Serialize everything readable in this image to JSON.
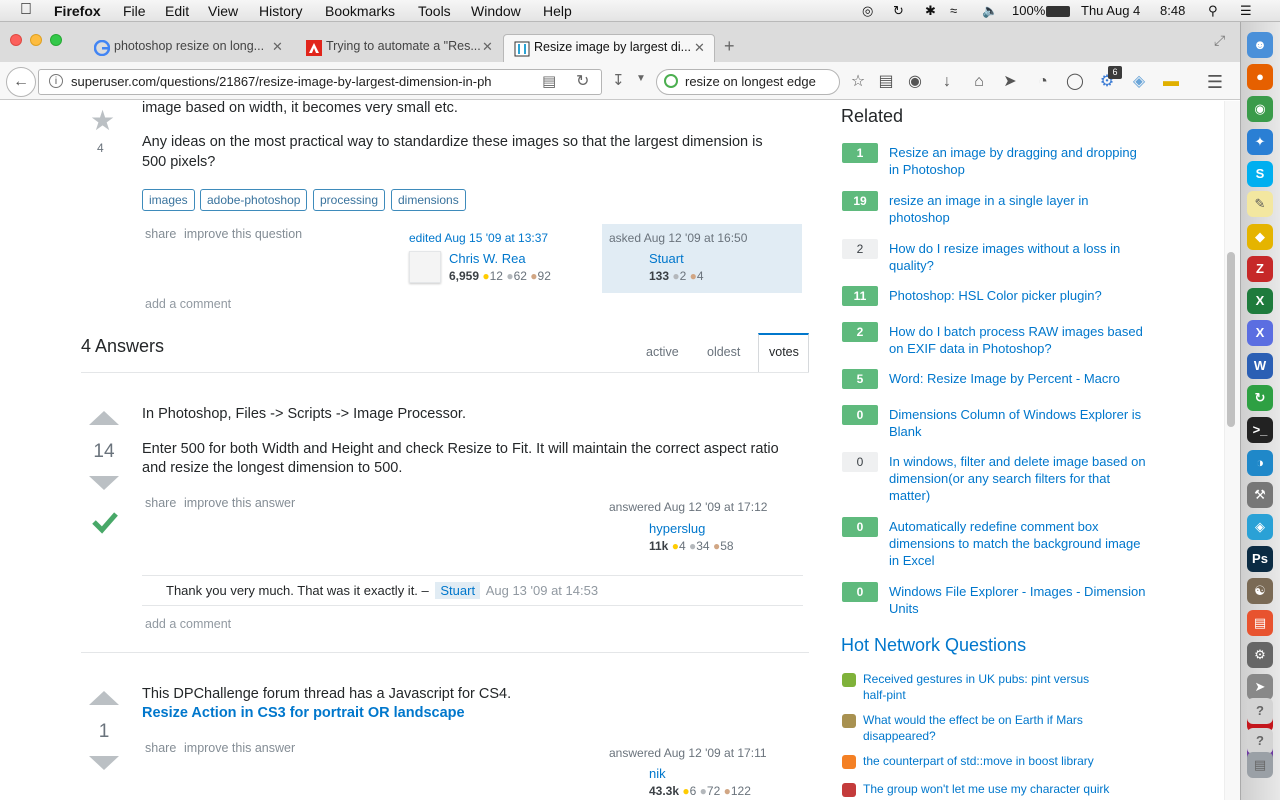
{
  "menubar": {
    "app": "Firefox",
    "items": [
      "File",
      "Edit",
      "View",
      "History",
      "Bookmarks",
      "Tools",
      "Window",
      "Help"
    ],
    "battery": "100%",
    "clock_day": "Thu Aug 4",
    "clock_time": "8:48"
  },
  "tabs": [
    {
      "title": "photoshop resize on long...",
      "icon": "google-icon"
    },
    {
      "title": "Trying to automate a \"Res...",
      "icon": "adobe-icon"
    },
    {
      "title": "Resize image by largest di...",
      "icon": "superuser-icon",
      "active": true
    }
  ],
  "nav": {
    "url": "superuser.com/questions/21867/resize-image-by-largest-dimension-in-ph",
    "search": "resize on longest edge",
    "badge_count": "6"
  },
  "question": {
    "text_line1": "image based on width, it becomes very small etc.",
    "text_line2": "Any ideas on the most practical way to standardize these images so that the largest dimension is",
    "text_line3": "500 pixels?",
    "fav_count": "4",
    "tags": [
      "images",
      "adobe-photoshop",
      "processing",
      "dimensions"
    ],
    "share": "share",
    "improve": "improve this question",
    "edited": "edited Aug 15 '09 at 13:37",
    "editor": "Chris W. Rea",
    "editor_rep": "6,959",
    "editor_gold": "12",
    "editor_silver": "62",
    "editor_bronze": "92",
    "asked": "asked Aug 12 '09 at 16:50",
    "asker": "Stuart",
    "asker_rep": "133",
    "asker_silver": "2",
    "asker_bronze": "4",
    "add_comment": "add a comment"
  },
  "answers_header": {
    "title": "4 Answers",
    "tabs": [
      "active",
      "oldest",
      "votes"
    ],
    "active_tab": "votes"
  },
  "answers": [
    {
      "votes": "14",
      "line1": "In Photoshop, Files -> Scripts -> Image Processor.",
      "line2": "Enter 500 for both Width and Height and check Resize to Fit. It will maintain the correct aspect ratio",
      "line3": "and resize the longest dimension to 500.",
      "share": "share",
      "improve": "improve this answer",
      "answered": "answered Aug 12 '09 at 17:12",
      "user": "hyperslug",
      "rep": "11k",
      "gold": "4",
      "silver": "34",
      "bronze": "58",
      "comment": "Thank you very much. That was it exactly it. –",
      "comment_user": "Stuart",
      "comment_date": "Aug 13 '09 at 14:53",
      "add_comment": "add a comment"
    },
    {
      "votes": "1",
      "line1": "This DPChallenge forum thread has a Javascript for CS4.",
      "link": "Resize Action in CS3 for portrait OR landscape",
      "share": "share",
      "improve": "improve this answer",
      "answered": "answered Aug 12 '09 at 17:11",
      "user": "nik",
      "rep": "43.3k",
      "gold": "6",
      "silver": "72",
      "bronze": "122"
    }
  ],
  "related": {
    "title": "Related",
    "items": [
      {
        "score": "1",
        "accepted": true,
        "text": "Resize an image by dragging and dropping in Photoshop"
      },
      {
        "score": "19",
        "accepted": true,
        "text": "resize an image in a single layer in photoshop"
      },
      {
        "score": "2",
        "accepted": false,
        "text": "How do I resize images without a loss in quality?"
      },
      {
        "score": "11",
        "accepted": true,
        "text": "Photoshop: HSL Color picker plugin?"
      },
      {
        "score": "2",
        "accepted": true,
        "text": "How do I batch process RAW images based on EXIF data in Photoshop?"
      },
      {
        "score": "5",
        "accepted": true,
        "text": "Word: Resize Image by Percent - Macro"
      },
      {
        "score": "0",
        "accepted": true,
        "text": "Dimensions Column of Windows Explorer is Blank"
      },
      {
        "score": "0",
        "accepted": false,
        "text": "In windows, filter and delete image based on dimension(or any search filters for that matter)"
      },
      {
        "score": "0",
        "accepted": true,
        "text": "Automatically redefine comment box dimensions to match the background image in Excel"
      },
      {
        "score": "0",
        "accepted": true,
        "text": "Windows File Explorer - Images - Dimension Units"
      }
    ]
  },
  "hot": {
    "title": "Hot Network Questions",
    "items": [
      {
        "text": "Received gestures in UK pubs: pint versus half-pint",
        "color": "#7fb23a"
      },
      {
        "text": "What would the effect be on Earth if Mars disappeared?",
        "color": "#a89150"
      },
      {
        "text": "the counterpart of std::move in boost library",
        "color": "#f48024"
      },
      {
        "text": "The group won't let me use my character quirk",
        "color": "#c43b3b"
      }
    ]
  }
}
